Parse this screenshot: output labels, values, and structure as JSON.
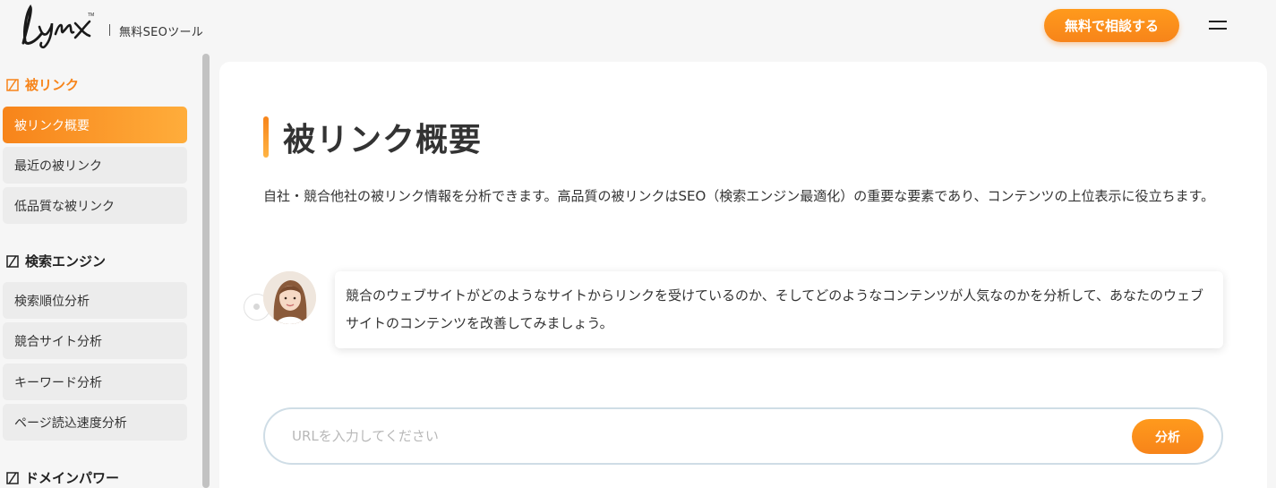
{
  "header": {
    "logo_text": "Lynx",
    "tagline": "無料SEOツール",
    "cta_label": "無料で相談する",
    "menu_icon": "hamburger-icon"
  },
  "sidebar": {
    "sections": [
      {
        "title": "被リンク",
        "icon": "link-section-icon",
        "items": [
          "被リンク概要",
          "最近の被リンク",
          "低品質な被リンク"
        ],
        "active_item": 0
      },
      {
        "title": "検索エンジン",
        "icon": "search-engine-section-icon",
        "items": [
          "検索順位分析",
          "競合サイト分析",
          "キーワード分析",
          "ページ読込速度分析"
        ]
      },
      {
        "title": "ドメインパワー",
        "icon": "domain-power-section-icon",
        "items": []
      }
    ]
  },
  "main": {
    "title": "被リンク概要",
    "description": "自社・競合他社の被リンク情報を分析できます。高品質の被リンクはSEO（検索エンジン最適化）の重要な要素であり、コンテンツの上位表示に役立ちます。",
    "advisor_message": "競合のウェブサイトがどのようなサイトからリンクを受けているのか、そしてどのようなコンテンツが人気なのかを分析して、あなたのウェブサイトのコンテンツを改善してみましょう。",
    "search": {
      "placeholder": "URLを入力してください",
      "value": "",
      "button_label": "分析"
    }
  },
  "colors": {
    "accent": "#f7841a",
    "accent_light": "#ffad3b",
    "sidebar_item_bg": "#ececec",
    "page_bg": "#f6f6f6"
  }
}
